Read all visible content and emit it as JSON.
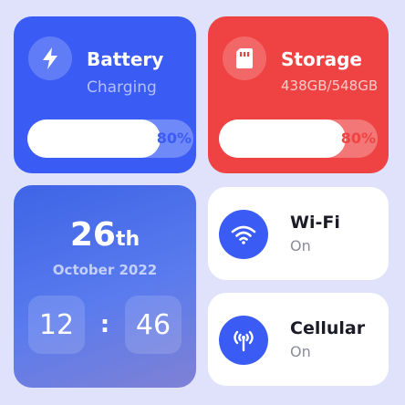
{
  "battery": {
    "title": "Battery",
    "status": "Charging",
    "percent_label": "80%",
    "level": 0.8,
    "icon": "lightning-icon",
    "color": "#3a5cf5"
  },
  "storage": {
    "title": "Storage",
    "usage": "438GB/548GB",
    "percent_label": "80%",
    "level": 0.8,
    "icon": "sd-card-icon",
    "color": "#ef4343"
  },
  "date": {
    "day": "26",
    "day_suffix": "th",
    "month_year": "October 2022",
    "hour": "12",
    "separator": ":",
    "minute": "46"
  },
  "wifi": {
    "title": "Wi-Fi",
    "status": "On",
    "icon": "wifi-icon"
  },
  "cellular": {
    "title": "Cellular",
    "status": "On",
    "icon": "cellular-antenna-icon"
  },
  "colors": {
    "background": "#e0e2fb",
    "accent": "#3a5cf5"
  }
}
